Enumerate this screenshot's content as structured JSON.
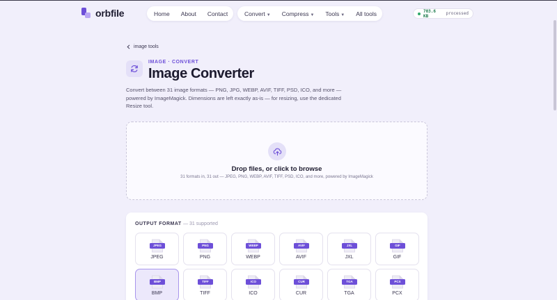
{
  "brand": {
    "name": "orbfile"
  },
  "nav": {
    "main": [
      "Home",
      "About",
      "Contact"
    ],
    "tools": [
      {
        "label": "Convert",
        "dropdown": true
      },
      {
        "label": "Compress",
        "dropdown": true
      },
      {
        "label": "Tools",
        "dropdown": true
      },
      {
        "label": "All tools",
        "dropdown": false
      }
    ]
  },
  "status": {
    "value": "703.6 KB",
    "label": "processed",
    "color": "#2fa86a"
  },
  "breadcrumb": {
    "label": "image tools"
  },
  "header": {
    "eyebrow": "IMAGE · CONVERT",
    "title": "Image Converter",
    "description": "Convert between 31 image formats — PNG, JPG, WEBP, AVIF, TIFF, PSD, ICO, and more — powered by ImageMagick. Dimensions are left exactly as-is — for resizing, use the dedicated Resize tool."
  },
  "dropzone": {
    "title": "Drop files, or click to browse",
    "subtitle": "31 formats in, 31 out — JPEG, PNG, WEBP, AVIF, TIFF, PSD, ICO, and more, powered by ImageMagick"
  },
  "output": {
    "heading": "OUTPUT FORMAT",
    "count": "— 31 supported",
    "formats": [
      {
        "badge": "JPEG",
        "name": "JPEG",
        "selected": false
      },
      {
        "badge": "PNG",
        "name": "PNG",
        "selected": false
      },
      {
        "badge": "WEBP",
        "name": "WEBP",
        "selected": false
      },
      {
        "badge": "AVIF",
        "name": "AVIF",
        "selected": false
      },
      {
        "badge": "JXL",
        "name": "JXL",
        "selected": false
      },
      {
        "badge": "GIF",
        "name": "GIF",
        "selected": false
      },
      {
        "badge": "BMP",
        "name": "BMP",
        "selected": true
      },
      {
        "badge": "TIFF",
        "name": "TIFF",
        "selected": false
      },
      {
        "badge": "ICO",
        "name": "ICO",
        "selected": false
      },
      {
        "badge": "CUR",
        "name": "CUR",
        "selected": false
      },
      {
        "badge": "TGA",
        "name": "TGA",
        "selected": false
      },
      {
        "badge": "PCX",
        "name": "PCX",
        "selected": false
      }
    ]
  },
  "colors": {
    "accent": "#6d4fd8",
    "background": "#f1effb",
    "surface": "#ffffff"
  },
  "icons": {
    "logo": "orbfile-logo-icon",
    "breadcrumb": "chevron-left-icon",
    "title": "refresh-icon",
    "upload": "upload-cloud-icon",
    "file": "file-icon"
  }
}
